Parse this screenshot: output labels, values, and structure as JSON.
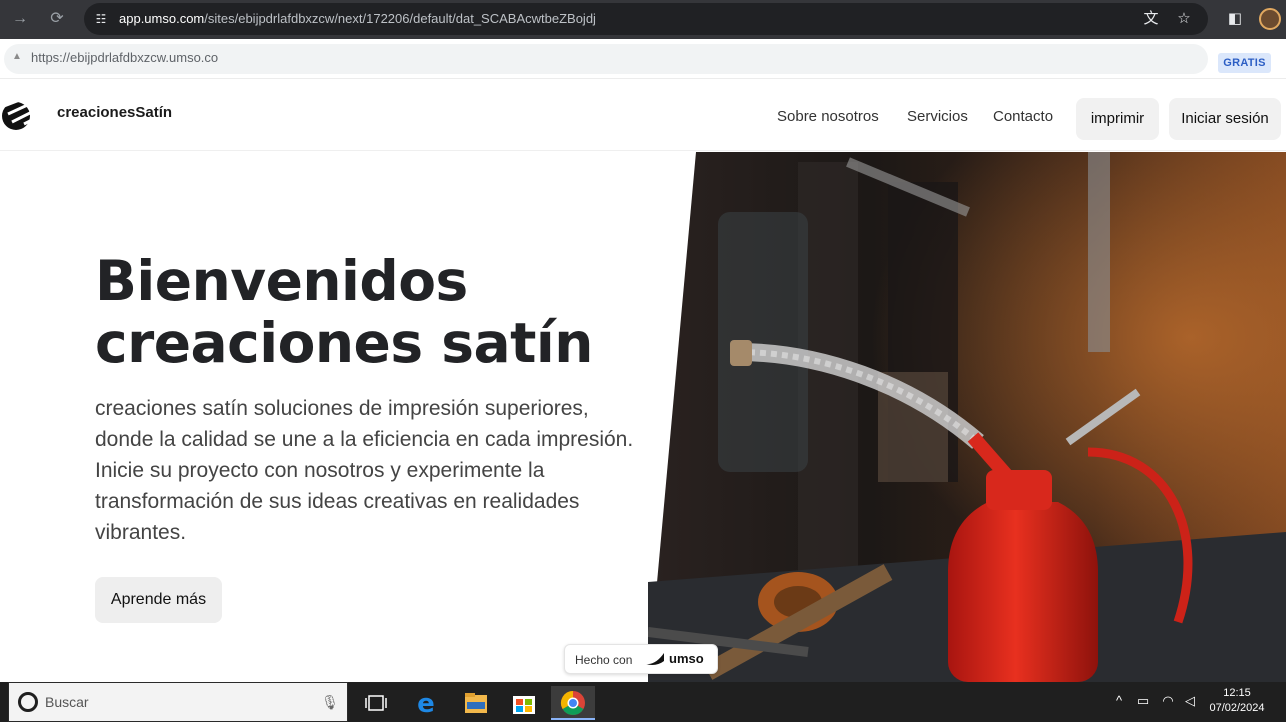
{
  "browser": {
    "nav_back_icon": "arrow-right-icon",
    "url_host": "app.umso.com",
    "url_path": "/sites/ebijpdrlafdbxzcw/next/172206/default/dat_SCABAcwtbeZBojdj",
    "sub_url": "https://ebijpdrlafdbxzcw.umso.co",
    "plan_badge": "GRATIS"
  },
  "site": {
    "brand": "creacionesSatín",
    "nav": {
      "about": "Sobre nosotros",
      "services": "Servicios",
      "contact": "Contacto"
    },
    "buttons": {
      "print": "imprimir",
      "login": "Iniciar sesión"
    }
  },
  "hero": {
    "title_line1": "Bienvenidos",
    "title_line2": "creaciones satín",
    "description": "creaciones satín soluciones de impresión superiores, donde la calidad se une a la eficiencia en cada impresión. Inicie su proyecto con nosotros y experimente la transformación de sus ideas creativas en realidades vibrantes.",
    "cta": "Aprende más"
  },
  "badge": {
    "prefix": "Hecho con",
    "brand": "umso"
  },
  "taskbar": {
    "search_placeholder": "Buscar",
    "time": "12:15",
    "date": "07/02/2024"
  },
  "colors": {
    "accent_badge_bg": "#dbe7fb",
    "accent_badge_text": "#2c5ec4",
    "oil_can_red": "#d8281c"
  }
}
